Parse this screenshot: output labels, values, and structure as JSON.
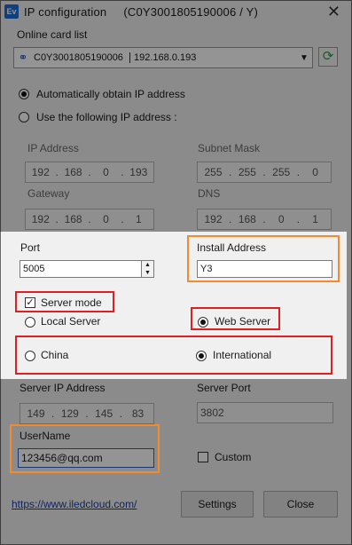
{
  "window": {
    "icon_text": "Ev",
    "title": "IP configuration",
    "card_id": "(C0Y3001805190006 / Y)",
    "close_glyph": "✕"
  },
  "online_card": {
    "label": "Online card list",
    "card_id": "C0Y3001805190006",
    "ip": "192.168.0.193"
  },
  "ip_mode": {
    "auto_label": "Automatically obtain IP address",
    "manual_label": "Use the following IP address :",
    "selected": "auto"
  },
  "ip_fields": {
    "ip_label": "IP Address",
    "ip": [
      "192",
      "168",
      "0",
      "193"
    ],
    "mask_label": "Subnet Mask",
    "mask": [
      "255",
      "255",
      "255",
      "0"
    ],
    "gateway_label": "Gateway",
    "gateway": [
      "192",
      "168",
      "0",
      "1"
    ],
    "dns_label": "DNS",
    "dns": [
      "192",
      "168",
      "0",
      "1"
    ]
  },
  "port": {
    "label": "Port",
    "value": "5005"
  },
  "install": {
    "label": "Install Address",
    "value": "Y3"
  },
  "server": {
    "mode_label": "Server mode",
    "mode_checked": true,
    "local_label": "Local Server",
    "web_label": "Web Server",
    "selected": "web",
    "china_label": "China",
    "intl_label": "International",
    "region_selected": "international"
  },
  "server_ip": {
    "label": "Server IP Address",
    "ip": [
      "149",
      "129",
      "145",
      "83"
    ]
  },
  "server_port": {
    "label": "Server Port",
    "value": "3802"
  },
  "username": {
    "label": "UserName",
    "value": "123456@qq.com"
  },
  "custom": {
    "label": "Custom",
    "checked": false
  },
  "footer": {
    "link": "https://www.iledcloud.com/",
    "settings": "Settings",
    "close": "Close"
  },
  "colors": {
    "highlight_orange": "#f08c2e",
    "highlight_red": "#e02020",
    "link": "#1a3ea8"
  }
}
